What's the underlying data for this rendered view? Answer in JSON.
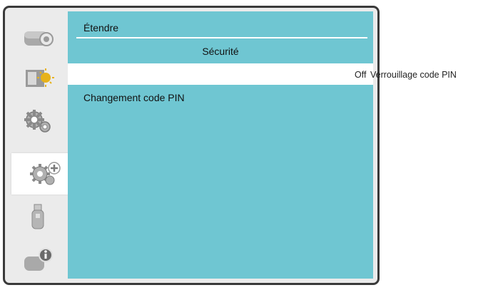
{
  "title": "Étendre",
  "section": "Sécurité",
  "rows": [
    {
      "label": "Verrouillage code PIN",
      "value": "Off"
    },
    {
      "label": "Changement code PIN"
    }
  ],
  "sidebar": {
    "items": [
      {
        "icon": "camera-icon"
      },
      {
        "icon": "picture-adjust-icon"
      },
      {
        "icon": "gear-icon"
      },
      {
        "icon": "gear-plus-icon",
        "active": true
      },
      {
        "icon": "usb-icon"
      },
      {
        "icon": "info-icon"
      }
    ]
  },
  "colors": {
    "panel": "#6fc6d2",
    "frame": "#ebebeb",
    "selected_row": "#ffffff"
  }
}
